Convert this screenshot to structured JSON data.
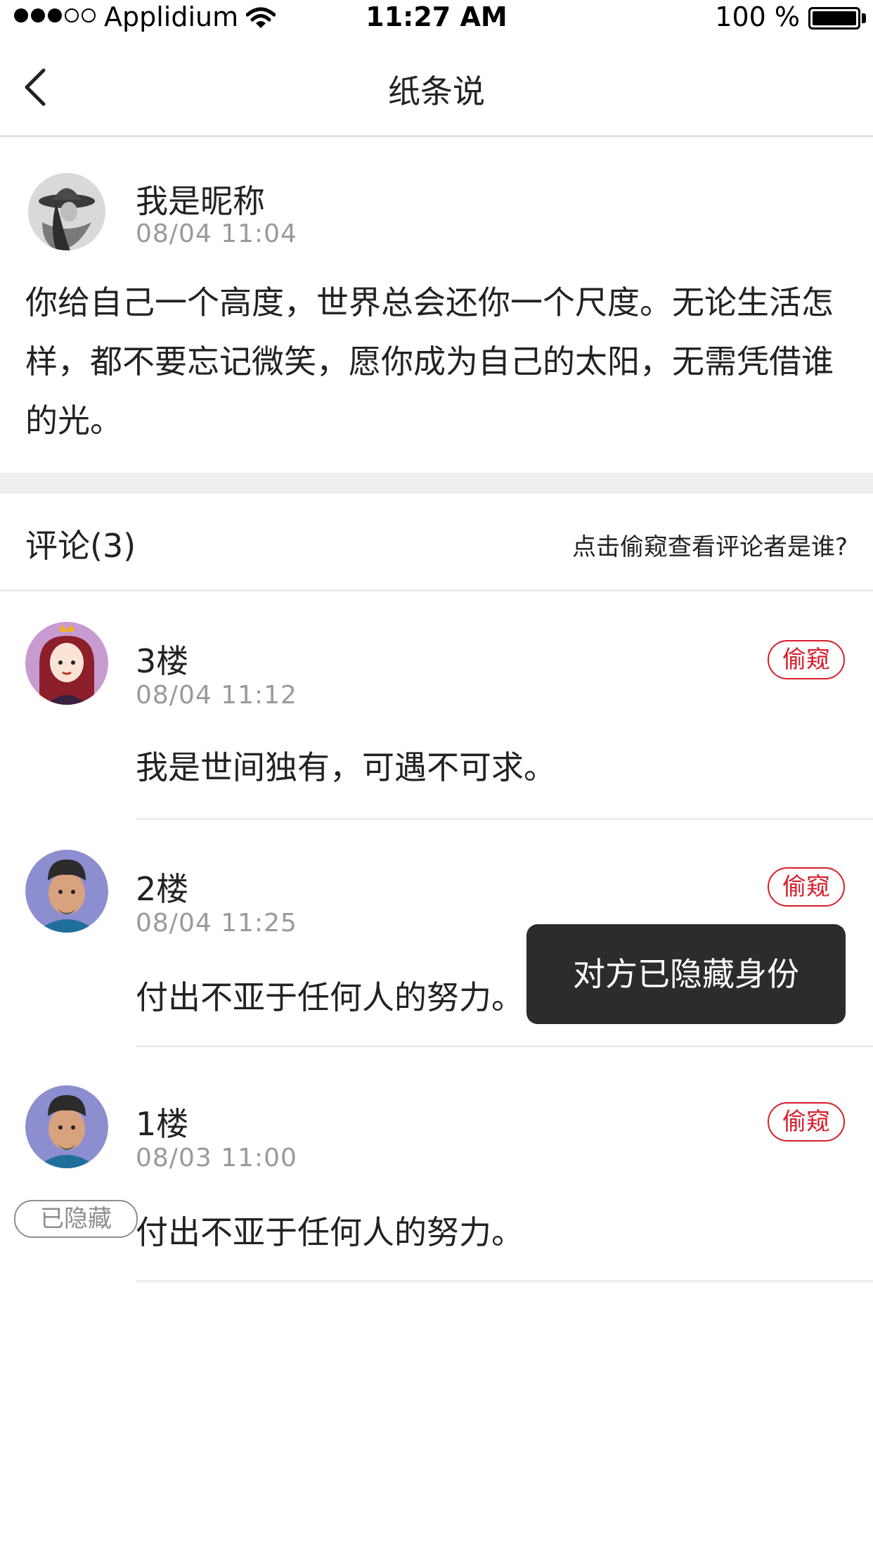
{
  "status_bar": {
    "carrier": "Applidium",
    "time": "11:27 AM",
    "battery": "100 %",
    "signal_bars_filled": 3,
    "signal_bars_total": 5
  },
  "nav": {
    "title": "纸条说",
    "back_icon": "chevron-left-icon"
  },
  "post": {
    "author": "我是昵称",
    "time": "08/04   11:04",
    "content": "你给自己一个高度，世界总会还你一个尺度。无论生活怎样，都不要忘记微笑，愿你成为自己的太阳，无需凭借谁的光。"
  },
  "comments_header": {
    "title": "评论(3)",
    "hint": "点击偷窥查看评论者是谁?"
  },
  "comments": [
    {
      "floor": "3楼",
      "time": "08/04   11:12",
      "text": "我是世间独有，可遇不可求。",
      "peek_label": "偷窥"
    },
    {
      "floor": "2楼",
      "time": "08/04   11:25",
      "text": "付出不亚于任何人的努力。",
      "peek_label": "偷窥"
    },
    {
      "floor": "1楼",
      "time": "08/03   11:00",
      "text": "付出不亚于任何人的努力。",
      "peek_label": "偷窥",
      "badge": "已隐藏"
    }
  ],
  "toast": {
    "text": "对方已隐藏身份"
  },
  "colors": {
    "accent_red": "#d81e2b",
    "toast_bg": "#2c2c2c",
    "meta_gray": "#9a9a9a",
    "divider": "#ececec"
  }
}
